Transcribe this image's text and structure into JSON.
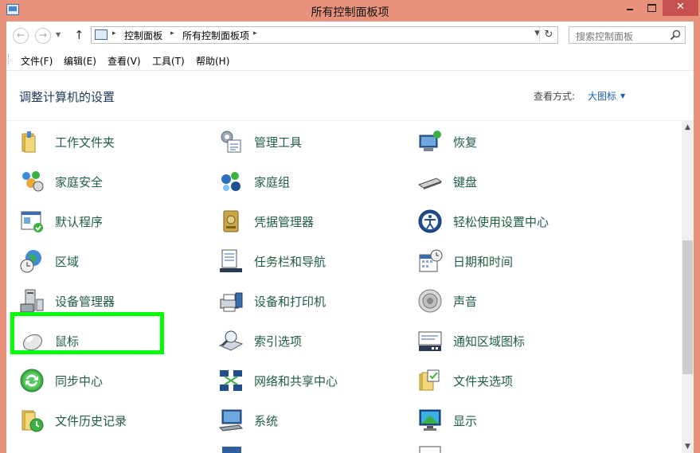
{
  "window": {
    "title": "所有控制面板项",
    "close_glyph": "✕"
  },
  "address": {
    "crumbs": [
      "控制面板",
      "所有控制面板项"
    ],
    "separator": "▸",
    "search_placeholder": "搜索控制面板"
  },
  "menu": [
    "文件(F)",
    "编辑(E)",
    "查看(V)",
    "工具(T)",
    "帮助(H)"
  ],
  "header": {
    "title": "调整计算机的设置",
    "view_label": "查看方式:",
    "view_value": "大图标"
  },
  "items": [
    {
      "label": "工作文件夹",
      "icon": "work-folders-icon"
    },
    {
      "label": "管理工具",
      "icon": "admin-tools-icon"
    },
    {
      "label": "恢复",
      "icon": "recovery-icon"
    },
    {
      "label": "家庭安全",
      "icon": "family-safety-icon"
    },
    {
      "label": "家庭组",
      "icon": "homegroup-icon"
    },
    {
      "label": "键盘",
      "icon": "keyboard-icon"
    },
    {
      "label": "默认程序",
      "icon": "default-programs-icon"
    },
    {
      "label": "凭据管理器",
      "icon": "credential-manager-icon"
    },
    {
      "label": "轻松使用设置中心",
      "icon": "ease-of-access-icon"
    },
    {
      "label": "区域",
      "icon": "region-icon"
    },
    {
      "label": "任务栏和导航",
      "icon": "taskbar-icon"
    },
    {
      "label": "日期和时间",
      "icon": "date-time-icon"
    },
    {
      "label": "设备管理器",
      "icon": "device-manager-icon"
    },
    {
      "label": "设备和打印机",
      "icon": "devices-printers-icon"
    },
    {
      "label": "声音",
      "icon": "sound-icon"
    },
    {
      "label": "鼠标",
      "icon": "mouse-icon"
    },
    {
      "label": "索引选项",
      "icon": "indexing-icon"
    },
    {
      "label": "通知区域图标",
      "icon": "notification-area-icon"
    },
    {
      "label": "同步中心",
      "icon": "sync-center-icon"
    },
    {
      "label": "网络和共享中心",
      "icon": "network-icon"
    },
    {
      "label": "文件夹选项",
      "icon": "folder-options-icon"
    },
    {
      "label": "文件历史记录",
      "icon": "file-history-icon"
    },
    {
      "label": "系统",
      "icon": "system-icon"
    },
    {
      "label": "显示",
      "icon": "display-icon"
    }
  ],
  "colors": {
    "title_bar": "#e8927c",
    "item_text": "#1f5f3f",
    "highlight": "#00ff00"
  }
}
